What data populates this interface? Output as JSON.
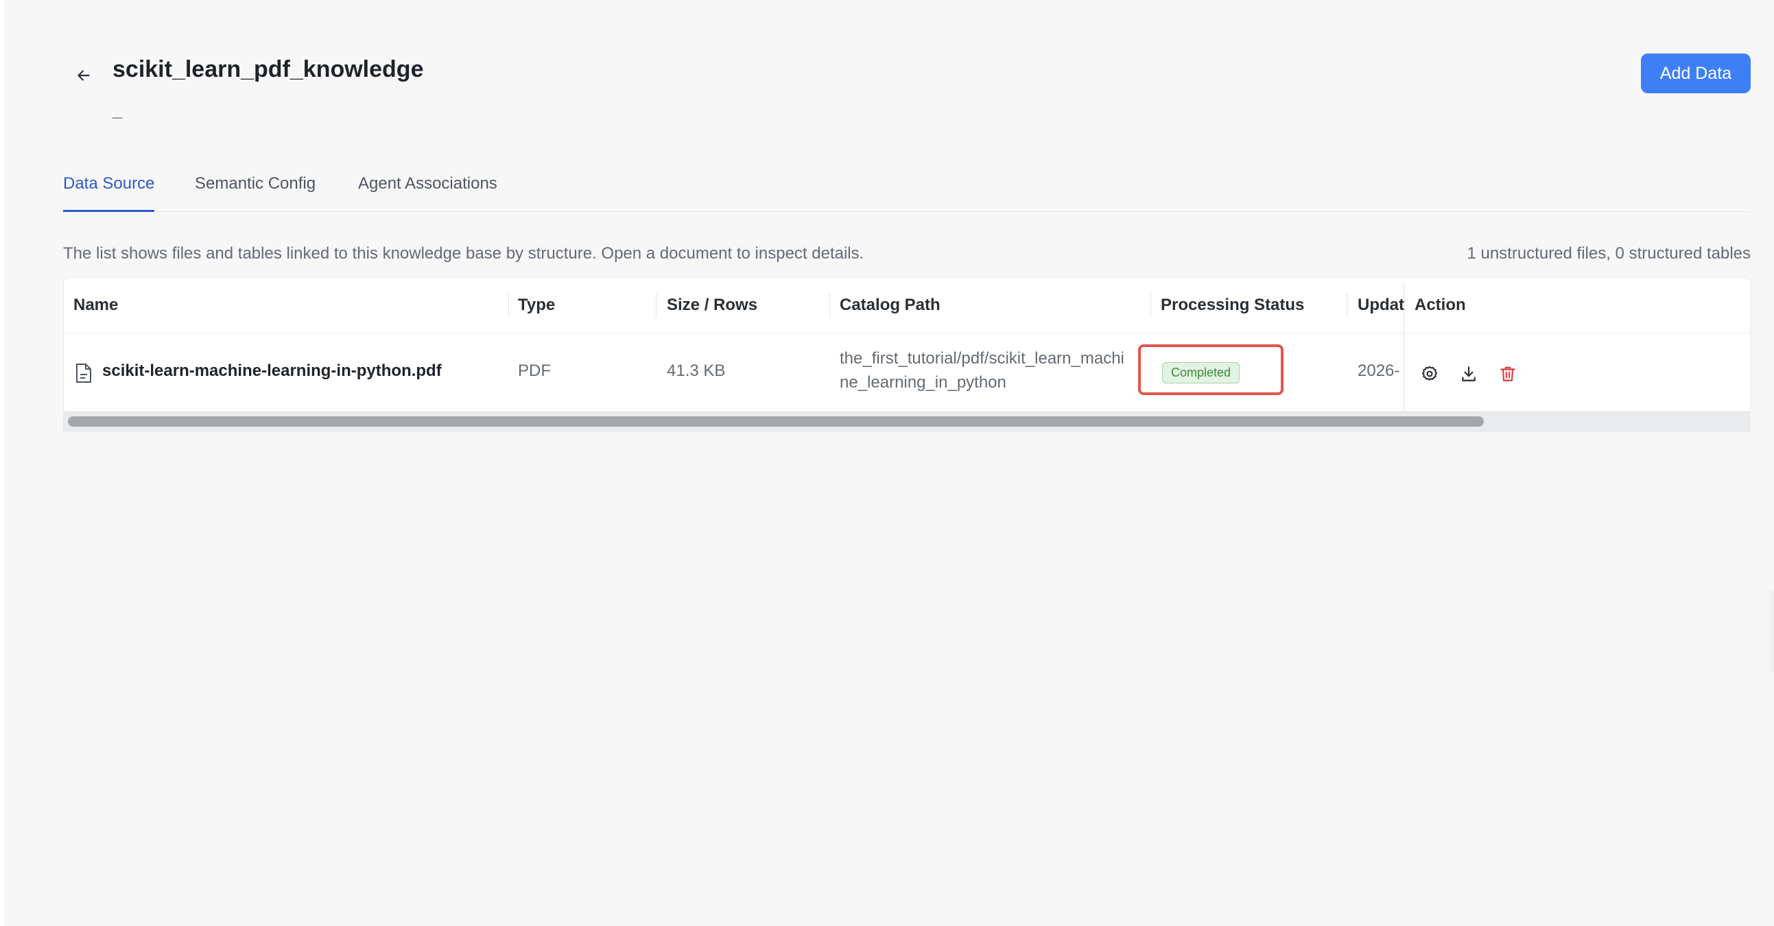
{
  "header": {
    "title": "scikit_learn_pdf_knowledge",
    "subtitle": "_",
    "add_button_label": "Add Data"
  },
  "tabs": [
    {
      "label": "Data Source",
      "active": true
    },
    {
      "label": "Semantic Config",
      "active": false
    },
    {
      "label": "Agent Associations",
      "active": false
    }
  ],
  "info": {
    "description": "The list shows files and tables linked to this knowledge base by structure. Open a document to inspect details.",
    "summary": "1 unstructured files, 0 structured tables"
  },
  "table": {
    "columns": [
      "Name",
      "Type",
      "Size / Rows",
      "Catalog Path",
      "Processing Status",
      "Updated",
      "Action"
    ],
    "rows": [
      {
        "name": "scikit-learn-machine-learning-in-python.pdf",
        "type": "PDF",
        "size": "41.3 KB",
        "path_line1": "the_first_tutorial/pdf/scikit_learn_machi",
        "path_line2": "ne_learning_in_python",
        "status": "Completed",
        "updated": "2026-"
      }
    ]
  },
  "colors": {
    "accent": "#3f7ff5",
    "active_tab": "#2c58c9",
    "status_bg": "#e3f3e3",
    "status_text": "#3c8a3c",
    "highlight": "#e2554d",
    "delete_icon": "#e03c3c"
  },
  "icons": {
    "back": "arrow-left-icon",
    "file": "file-document-icon",
    "settings": "gear-icon",
    "download": "download-icon",
    "delete": "trash-icon"
  }
}
